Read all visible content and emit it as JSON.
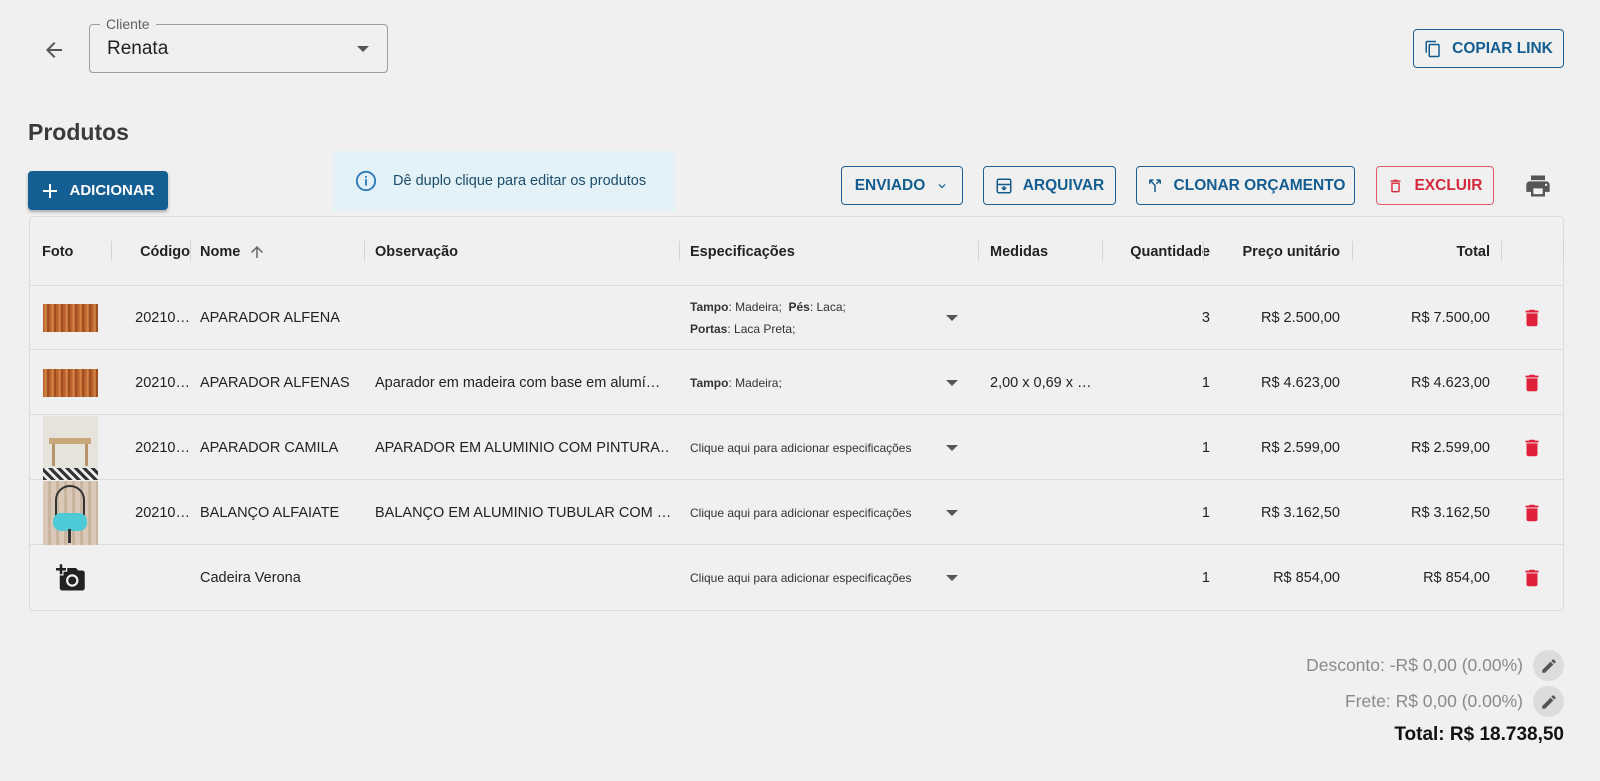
{
  "header": {
    "client_label": "Cliente",
    "client_value": "Renata",
    "copy_link_label": "COPIAR LINK"
  },
  "page_title": "Produtos",
  "toolbar": {
    "add_label": "ADICIONAR",
    "info_text": "Dê duplo clique para editar os produtos",
    "status_label": "ENVIADO",
    "archive_label": "ARQUIVAR",
    "clone_label": "CLONAR ORÇAMENTO",
    "delete_label": "EXCLUIR"
  },
  "table": {
    "columns": [
      "Foto",
      "Código",
      "Nome",
      "Observação",
      "Especificações",
      "Medidas",
      "Quantidade",
      "Preço unitário",
      "Total"
    ],
    "rows": [
      {
        "codigo": "20210…",
        "nome": "APARADOR ALFENA",
        "obs": "",
        "medidas": "",
        "quantidade": "3",
        "preco": "R$ 2.500,00",
        "total": "R$ 7.500,00"
      },
      {
        "codigo": "20210…",
        "nome": "APARADOR ALFENAS",
        "obs": "Aparador em madeira com base em alumí…",
        "medidas": "2,00 x 0,69 x …",
        "quantidade": "1",
        "preco": "R$ 4.623,00",
        "total": "R$ 4.623,00"
      },
      {
        "codigo": "20210…",
        "nome": "APARADOR CAMILA",
        "obs": "APARADOR EM ALUMINIO COM PINTURA…",
        "medidas": "",
        "quantidade": "1",
        "preco": "R$ 2.599,00",
        "total": "R$ 2.599,00"
      },
      {
        "codigo": "20210…",
        "nome": "BALANÇO ALFAIATE",
        "obs": "BALANÇO EM ALUMINIO TUBULAR COM …",
        "medidas": "",
        "quantidade": "1",
        "preco": "R$ 3.162,50",
        "total": "R$ 3.162,50"
      },
      {
        "codigo": "",
        "nome": "Cadeira Verona",
        "obs": "",
        "medidas": "",
        "quantidade": "1",
        "preco": "R$ 854,00",
        "total": "R$ 854,00"
      }
    ],
    "specs": {
      "r0": {
        "k1": "Tampo",
        "v1": ": Madeira;",
        "k2": "Pés",
        "v2": ": Laca;",
        "k3": "Portas",
        "v3": ": Laca Preta;"
      },
      "r1": {
        "k1": "Tampo",
        "v1": ": Madeira;"
      },
      "placeholder": "Clique aqui para adicionar especificações"
    }
  },
  "summary": {
    "discount": "Desconto: -R$ 0,00 (0.00%)",
    "freight": "Frete: R$ 0,00 (0.00%)",
    "total": "Total: R$ 18.738,50"
  },
  "colors": {
    "primary": "#135e92",
    "danger": "#d42a3c",
    "info_bg": "#e3f1f9"
  }
}
